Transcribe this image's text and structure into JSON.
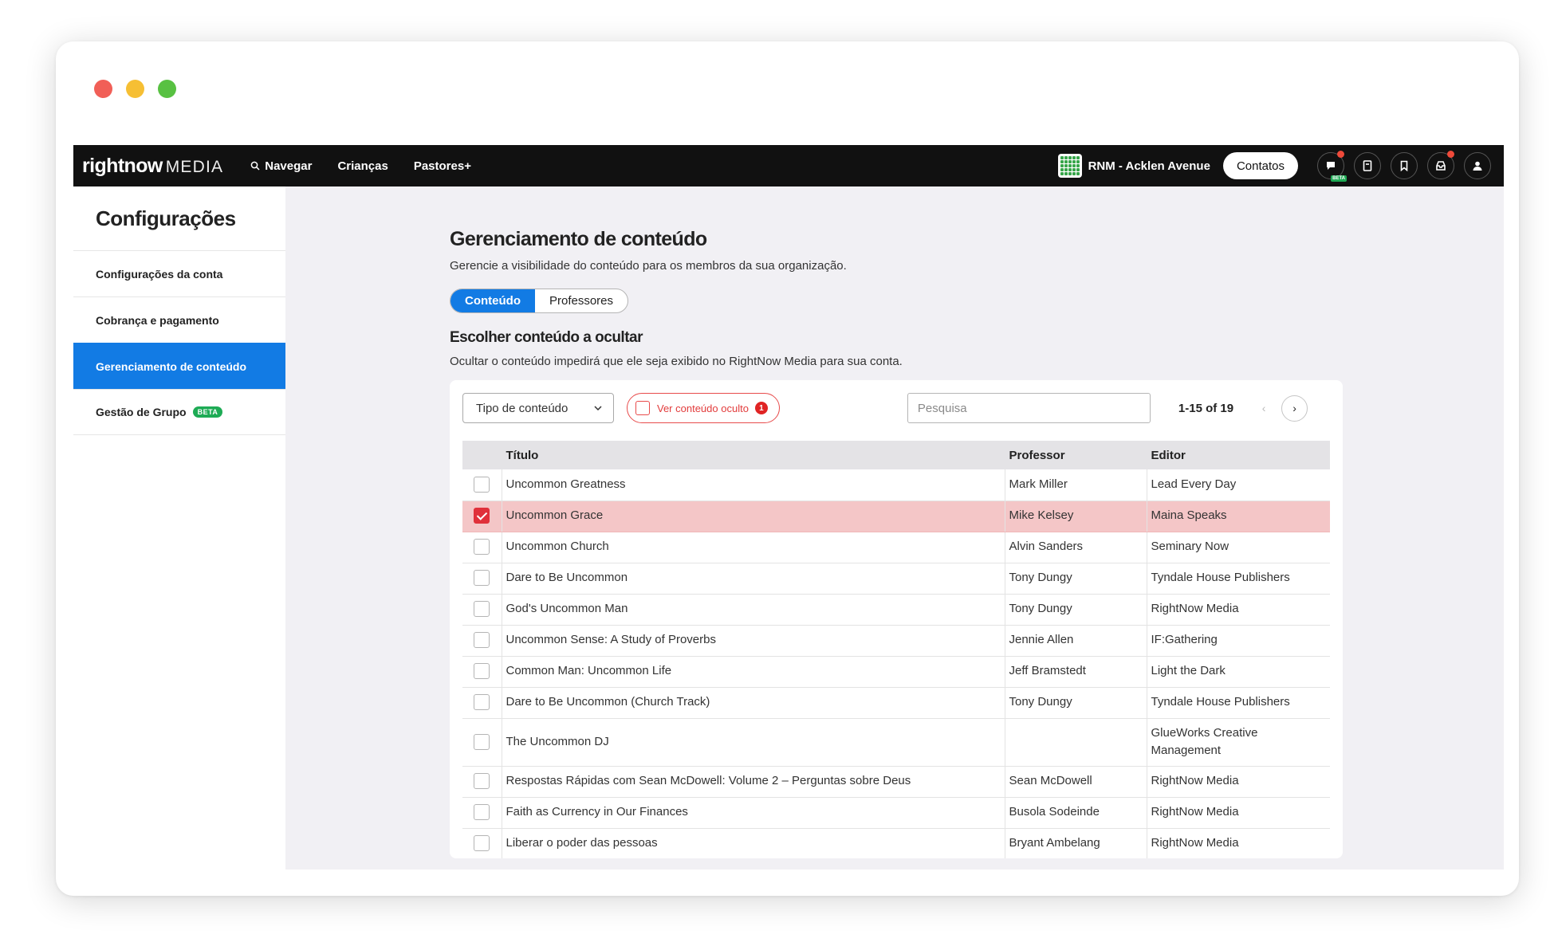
{
  "nav": {
    "brand_bold": "rightnow",
    "brand_light": "MEDIA",
    "items": [
      {
        "label": "Navegar",
        "icon": "search-icon"
      },
      {
        "label": "Crianças"
      },
      {
        "label": "Pastores+"
      }
    ],
    "org_name": "RNM - Acklen Avenue",
    "contacts_label": "Contatos",
    "beta_label": "BETA"
  },
  "sidebar": {
    "title": "Configurações",
    "items": [
      {
        "label": "Configurações da conta"
      },
      {
        "label": "Cobrança e pagamento"
      },
      {
        "label": "Gerenciamento de conteúdo",
        "active": true
      },
      {
        "label": "Gestão de Grupo",
        "badge": "BETA"
      }
    ]
  },
  "main": {
    "title": "Gerenciamento de conteúdo",
    "description": "Gerencie a visibilidade do conteúdo para os membros da sua organização.",
    "tabs": [
      "Conteúdo",
      "Professores"
    ],
    "section_title": "Escolher conteúdo a ocultar",
    "section_description": "Ocultar o conteúdo impedirá que ele seja exibido no RightNow Media para sua conta.",
    "filter": {
      "type_label": "Tipo de conteúdo",
      "hidden_label": "Ver conteúdo oculto",
      "hidden_count": "1",
      "search_placeholder": "Pesquisa",
      "pagination": "1-15 of 19"
    },
    "table": {
      "headers": {
        "title": "Título",
        "teacher": "Professor",
        "publisher": "Editor"
      },
      "rows": [
        {
          "title": "Uncommon Greatness",
          "teacher": "Mark Miller",
          "publisher": "Lead Every Day",
          "checked": false
        },
        {
          "title": "Uncommon Grace",
          "teacher": "Mike Kelsey",
          "publisher": "Maina Speaks",
          "checked": true
        },
        {
          "title": "Uncommon Church",
          "teacher": "Alvin Sanders",
          "publisher": "Seminary Now",
          "checked": false
        },
        {
          "title": "Dare to Be Uncommon",
          "teacher": "Tony Dungy",
          "publisher": "Tyndale House Publishers",
          "checked": false
        },
        {
          "title": "God's Uncommon Man",
          "teacher": "Tony Dungy",
          "publisher": "RightNow Media",
          "checked": false
        },
        {
          "title": "Uncommon Sense: A Study of Proverbs",
          "teacher": "Jennie Allen",
          "publisher": "IF:Gathering",
          "checked": false
        },
        {
          "title": "Common Man: Uncommon Life",
          "teacher": "Jeff Bramstedt",
          "publisher": "Light the Dark",
          "checked": false
        },
        {
          "title": "Dare to Be Uncommon (Church Track)",
          "teacher": "Tony Dungy",
          "publisher": "Tyndale House Publishers",
          "checked": false
        },
        {
          "title": "The Uncommon DJ",
          "teacher": "",
          "publisher": "GlueWorks Creative Management",
          "checked": false,
          "tall": true
        },
        {
          "title": "Respostas Rápidas com Sean McDowell: Volume 2 – Perguntas sobre Deus",
          "teacher": "Sean McDowell",
          "publisher": "RightNow Media",
          "checked": false
        },
        {
          "title": "Faith as Currency in Our Finances",
          "teacher": "Busola Sodeinde",
          "publisher": "RightNow Media",
          "checked": false
        },
        {
          "title": "Liberar o poder das pessoas",
          "teacher": "Bryant Ambelang",
          "publisher": "RightNow Media",
          "checked": false
        }
      ]
    }
  },
  "colors": {
    "accent": "#127be4",
    "danger": "#e0303a",
    "selected_row": "#f4c6c7",
    "navbar": "#111111",
    "beta": "#1eab55"
  }
}
